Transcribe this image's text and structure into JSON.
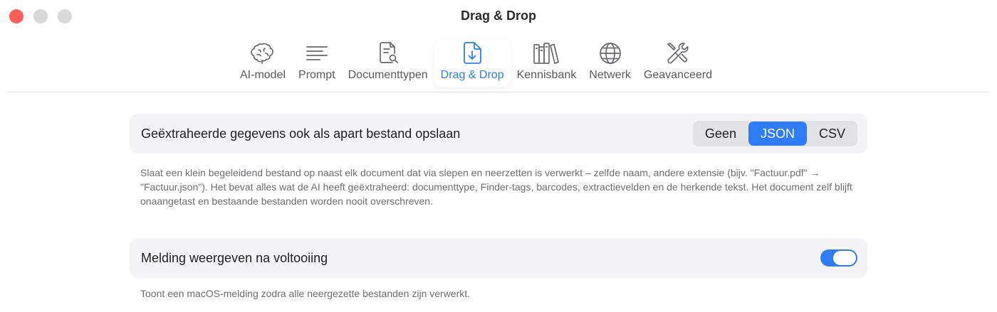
{
  "window": {
    "title": "Drag & Drop"
  },
  "toolbar": {
    "items": [
      {
        "label": "AI-model",
        "icon": "brain-icon"
      },
      {
        "label": "Prompt",
        "icon": "text-lines-icon"
      },
      {
        "label": "Documenttypen",
        "icon": "document-search-icon"
      },
      {
        "label": "Drag & Drop",
        "icon": "document-download-icon",
        "active": true
      },
      {
        "label": "Kennisbank",
        "icon": "books-icon"
      },
      {
        "label": "Netwerk",
        "icon": "globe-icon"
      },
      {
        "label": "Geavanceerd",
        "icon": "tools-icon"
      }
    ]
  },
  "settings": {
    "export": {
      "title": "Geëxtraheerde gegevens ook als apart bestand opslaan",
      "options": [
        "Geen",
        "JSON",
        "CSV"
      ],
      "selected": "JSON",
      "description": "Slaat een klein begeleidend bestand op naast elk document dat via slepen en neerzetten is verwerkt – zelfde naam, andere extensie (bijv. \"Factuur.pdf\" → \"Factuur.json\"). Het bevat alles wat de AI heeft geëxtraheerd: documenttype, Finder-tags, barcodes, extractievelden en de herkende tekst. Het document zelf blijft onaangetast en bestaande bestanden worden nooit overschreven."
    },
    "notification": {
      "title": "Melding weergeven na voltooiing",
      "enabled": true,
      "description": "Toont een macOS-melding zodra alle neergezette bestanden zijn verwerkt."
    }
  },
  "colors": {
    "accent": "#2f7cf6",
    "close": "#ff5f57",
    "inactive_light": "#d9d9d9"
  }
}
